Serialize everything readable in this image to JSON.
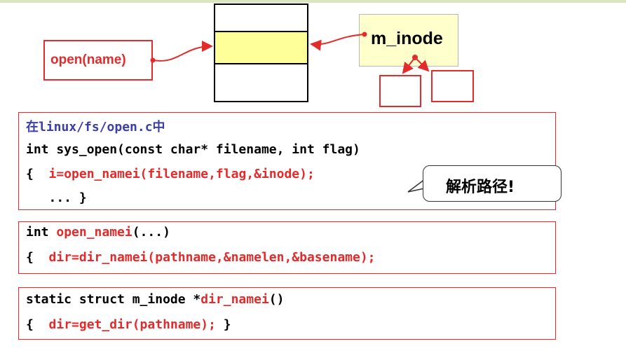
{
  "diagram": {
    "open_call": "open(name)",
    "inode_label": "m_inode",
    "callout": "解析路径!"
  },
  "code1": {
    "title": "在linux/fs/open.c中",
    "line2": "int sys_open(const char* filename, int flag)",
    "line3_prefix": "{  ",
    "line3_call": "i=open_namei(filename,flag,&inode);",
    "line4": "   ... }"
  },
  "code2": {
    "line1_prefix": "int ",
    "line1_func": "open_namei",
    "line1_suffix": "(...)",
    "line2_prefix": "{  ",
    "line2_call": "dir=dir_namei(pathname,&namelen,&basename);"
  },
  "code3": {
    "line1_prefix": "static struct m_inode *",
    "line1_func": "dir_namei",
    "line1_suffix": "()",
    "line2_prefix": "{  ",
    "line2_call": "dir=get_dir(pathname);",
    "line2_suffix": " }"
  },
  "colors": {
    "accent_red": "#e32b2b",
    "highlight_yellow": "#ffff99",
    "title_blue": "#3b3fa8"
  }
}
